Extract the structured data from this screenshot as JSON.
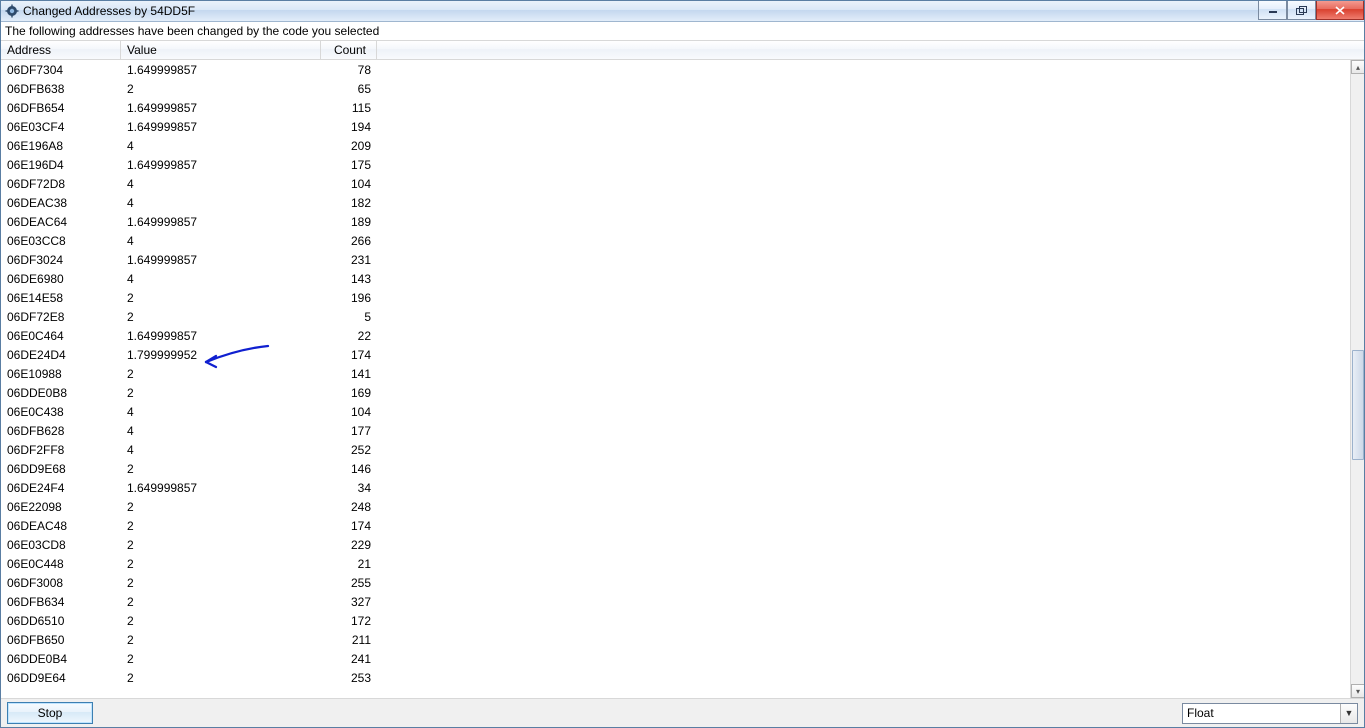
{
  "window": {
    "title": "Changed Addresses by 54DD5F",
    "description": "The following addresses have been changed by the code you selected"
  },
  "columns": {
    "address": "Address",
    "value": "Value",
    "count": "Count"
  },
  "rows": [
    {
      "address": "06DF7304",
      "value": "1.649999857",
      "count": "78"
    },
    {
      "address": "06DFB638",
      "value": "2",
      "count": "65"
    },
    {
      "address": "06DFB654",
      "value": "1.649999857",
      "count": "115"
    },
    {
      "address": "06E03CF4",
      "value": "1.649999857",
      "count": "194"
    },
    {
      "address": "06E196A8",
      "value": "4",
      "count": "209"
    },
    {
      "address": "06E196D4",
      "value": "1.649999857",
      "count": "175"
    },
    {
      "address": "06DF72D8",
      "value": "4",
      "count": "104"
    },
    {
      "address": "06DEAC38",
      "value": "4",
      "count": "182"
    },
    {
      "address": "06DEAC64",
      "value": "1.649999857",
      "count": "189"
    },
    {
      "address": "06E03CC8",
      "value": "4",
      "count": "266"
    },
    {
      "address": "06DF3024",
      "value": "1.649999857",
      "count": "231"
    },
    {
      "address": "06DE6980",
      "value": "4",
      "count": "143"
    },
    {
      "address": "06E14E58",
      "value": "2",
      "count": "196"
    },
    {
      "address": "06DF72E8",
      "value": "2",
      "count": "5"
    },
    {
      "address": "06E0C464",
      "value": "1.649999857",
      "count": "22"
    },
    {
      "address": "06DE24D4",
      "value": "1.799999952",
      "count": "174"
    },
    {
      "address": "06E10988",
      "value": "2",
      "count": "141"
    },
    {
      "address": "06DDE0B8",
      "value": "2",
      "count": "169"
    },
    {
      "address": "06E0C438",
      "value": "4",
      "count": "104"
    },
    {
      "address": "06DFB628",
      "value": "4",
      "count": "177"
    },
    {
      "address": "06DF2FF8",
      "value": "4",
      "count": "252"
    },
    {
      "address": "06DD9E68",
      "value": "2",
      "count": "146"
    },
    {
      "address": "06DE24F4",
      "value": "1.649999857",
      "count": "34"
    },
    {
      "address": "06E22098",
      "value": "2",
      "count": "248"
    },
    {
      "address": "06DEAC48",
      "value": "2",
      "count": "174"
    },
    {
      "address": "06E03CD8",
      "value": "2",
      "count": "229"
    },
    {
      "address": "06E0C448",
      "value": "2",
      "count": "21"
    },
    {
      "address": "06DF3008",
      "value": "2",
      "count": "255"
    },
    {
      "address": "06DFB634",
      "value": "2",
      "count": "327"
    },
    {
      "address": "06DD6510",
      "value": "2",
      "count": "172"
    },
    {
      "address": "06DFB650",
      "value": "2",
      "count": "211"
    },
    {
      "address": "06DDE0B4",
      "value": "2",
      "count": "241"
    },
    {
      "address": "06DD9E64",
      "value": "2",
      "count": "253"
    }
  ],
  "footer": {
    "stop_label": "Stop",
    "type_selected": "Float"
  }
}
